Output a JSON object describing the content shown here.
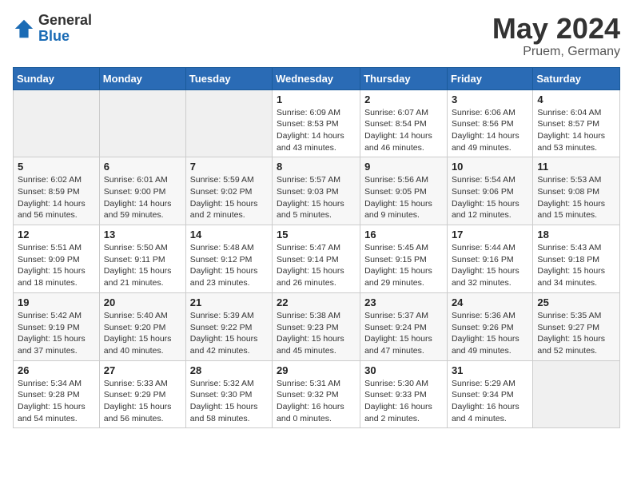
{
  "header": {
    "logo_general": "General",
    "logo_blue": "Blue",
    "title": "May 2024",
    "subtitle": "Pruem, Germany"
  },
  "weekdays": [
    "Sunday",
    "Monday",
    "Tuesday",
    "Wednesday",
    "Thursday",
    "Friday",
    "Saturday"
  ],
  "weeks": [
    [
      {
        "day": "",
        "info": ""
      },
      {
        "day": "",
        "info": ""
      },
      {
        "day": "",
        "info": ""
      },
      {
        "day": "1",
        "info": "Sunrise: 6:09 AM\nSunset: 8:53 PM\nDaylight: 14 hours\nand 43 minutes."
      },
      {
        "day": "2",
        "info": "Sunrise: 6:07 AM\nSunset: 8:54 PM\nDaylight: 14 hours\nand 46 minutes."
      },
      {
        "day": "3",
        "info": "Sunrise: 6:06 AM\nSunset: 8:56 PM\nDaylight: 14 hours\nand 49 minutes."
      },
      {
        "day": "4",
        "info": "Sunrise: 6:04 AM\nSunset: 8:57 PM\nDaylight: 14 hours\nand 53 minutes."
      }
    ],
    [
      {
        "day": "5",
        "info": "Sunrise: 6:02 AM\nSunset: 8:59 PM\nDaylight: 14 hours\nand 56 minutes."
      },
      {
        "day": "6",
        "info": "Sunrise: 6:01 AM\nSunset: 9:00 PM\nDaylight: 14 hours\nand 59 minutes."
      },
      {
        "day": "7",
        "info": "Sunrise: 5:59 AM\nSunset: 9:02 PM\nDaylight: 15 hours\nand 2 minutes."
      },
      {
        "day": "8",
        "info": "Sunrise: 5:57 AM\nSunset: 9:03 PM\nDaylight: 15 hours\nand 5 minutes."
      },
      {
        "day": "9",
        "info": "Sunrise: 5:56 AM\nSunset: 9:05 PM\nDaylight: 15 hours\nand 9 minutes."
      },
      {
        "day": "10",
        "info": "Sunrise: 5:54 AM\nSunset: 9:06 PM\nDaylight: 15 hours\nand 12 minutes."
      },
      {
        "day": "11",
        "info": "Sunrise: 5:53 AM\nSunset: 9:08 PM\nDaylight: 15 hours\nand 15 minutes."
      }
    ],
    [
      {
        "day": "12",
        "info": "Sunrise: 5:51 AM\nSunset: 9:09 PM\nDaylight: 15 hours\nand 18 minutes."
      },
      {
        "day": "13",
        "info": "Sunrise: 5:50 AM\nSunset: 9:11 PM\nDaylight: 15 hours\nand 21 minutes."
      },
      {
        "day": "14",
        "info": "Sunrise: 5:48 AM\nSunset: 9:12 PM\nDaylight: 15 hours\nand 23 minutes."
      },
      {
        "day": "15",
        "info": "Sunrise: 5:47 AM\nSunset: 9:14 PM\nDaylight: 15 hours\nand 26 minutes."
      },
      {
        "day": "16",
        "info": "Sunrise: 5:45 AM\nSunset: 9:15 PM\nDaylight: 15 hours\nand 29 minutes."
      },
      {
        "day": "17",
        "info": "Sunrise: 5:44 AM\nSunset: 9:16 PM\nDaylight: 15 hours\nand 32 minutes."
      },
      {
        "day": "18",
        "info": "Sunrise: 5:43 AM\nSunset: 9:18 PM\nDaylight: 15 hours\nand 34 minutes."
      }
    ],
    [
      {
        "day": "19",
        "info": "Sunrise: 5:42 AM\nSunset: 9:19 PM\nDaylight: 15 hours\nand 37 minutes."
      },
      {
        "day": "20",
        "info": "Sunrise: 5:40 AM\nSunset: 9:20 PM\nDaylight: 15 hours\nand 40 minutes."
      },
      {
        "day": "21",
        "info": "Sunrise: 5:39 AM\nSunset: 9:22 PM\nDaylight: 15 hours\nand 42 minutes."
      },
      {
        "day": "22",
        "info": "Sunrise: 5:38 AM\nSunset: 9:23 PM\nDaylight: 15 hours\nand 45 minutes."
      },
      {
        "day": "23",
        "info": "Sunrise: 5:37 AM\nSunset: 9:24 PM\nDaylight: 15 hours\nand 47 minutes."
      },
      {
        "day": "24",
        "info": "Sunrise: 5:36 AM\nSunset: 9:26 PM\nDaylight: 15 hours\nand 49 minutes."
      },
      {
        "day": "25",
        "info": "Sunrise: 5:35 AM\nSunset: 9:27 PM\nDaylight: 15 hours\nand 52 minutes."
      }
    ],
    [
      {
        "day": "26",
        "info": "Sunrise: 5:34 AM\nSunset: 9:28 PM\nDaylight: 15 hours\nand 54 minutes."
      },
      {
        "day": "27",
        "info": "Sunrise: 5:33 AM\nSunset: 9:29 PM\nDaylight: 15 hours\nand 56 minutes."
      },
      {
        "day": "28",
        "info": "Sunrise: 5:32 AM\nSunset: 9:30 PM\nDaylight: 15 hours\nand 58 minutes."
      },
      {
        "day": "29",
        "info": "Sunrise: 5:31 AM\nSunset: 9:32 PM\nDaylight: 16 hours\nand 0 minutes."
      },
      {
        "day": "30",
        "info": "Sunrise: 5:30 AM\nSunset: 9:33 PM\nDaylight: 16 hours\nand 2 minutes."
      },
      {
        "day": "31",
        "info": "Sunrise: 5:29 AM\nSunset: 9:34 PM\nDaylight: 16 hours\nand 4 minutes."
      },
      {
        "day": "",
        "info": ""
      }
    ]
  ]
}
